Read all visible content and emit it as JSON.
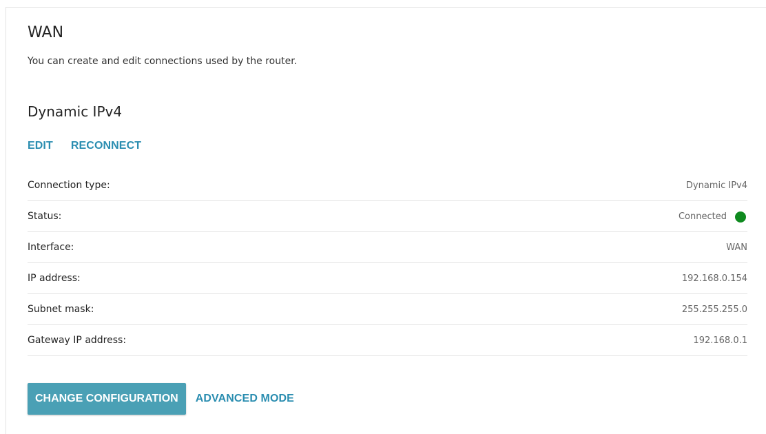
{
  "header": {
    "title": "WAN",
    "description": "You can create and edit connections used by the router."
  },
  "connection": {
    "name": "Dynamic IPv4",
    "actions": {
      "edit_label": "EDIT",
      "reconnect_label": "RECONNECT"
    },
    "details": [
      {
        "label": "Connection type:",
        "value": "Dynamic IPv4"
      },
      {
        "label": "Status:",
        "value": "Connected"
      },
      {
        "label": "Interface:",
        "value": "WAN"
      },
      {
        "label": "IP address:",
        "value": "192.168.0.154"
      },
      {
        "label": "Subnet mask:",
        "value": "255.255.255.0"
      },
      {
        "label": "Gateway IP address:",
        "value": "192.168.0.1"
      }
    ],
    "status_color": "#0f8a1f"
  },
  "footer": {
    "change_config_label": "CHANGE CONFIGURATION",
    "advanced_mode_label": "ADVANCED MODE"
  },
  "colors": {
    "accent": "#2a8db0",
    "button_bg": "#4aa0b5"
  }
}
